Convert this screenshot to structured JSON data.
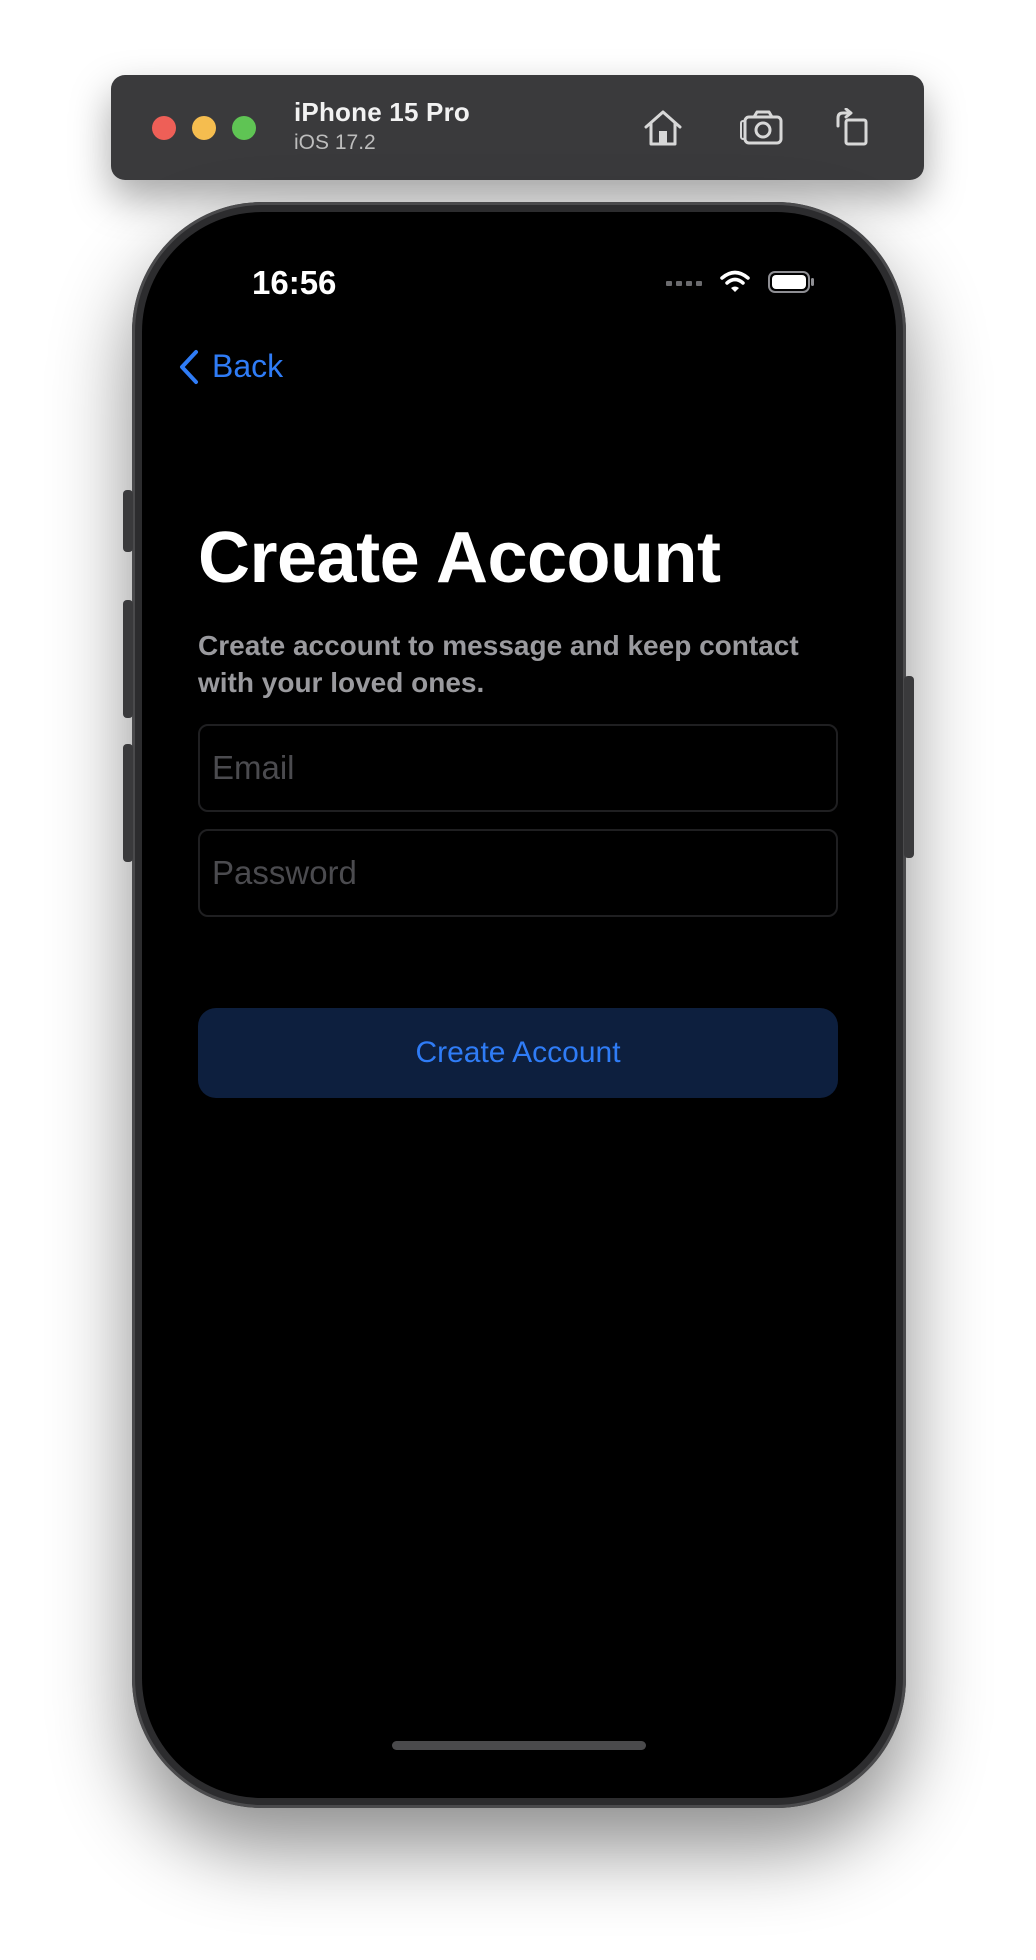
{
  "simulator": {
    "device_name": "iPhone 15 Pro",
    "os_version": "iOS 17.2",
    "toolbar_icons": [
      "home-icon",
      "screenshot-icon",
      "rotate-icon"
    ]
  },
  "status_bar": {
    "time": "16:56",
    "icons": [
      "signal-icon",
      "wifi-icon",
      "battery-icon"
    ]
  },
  "nav": {
    "back_label": "Back",
    "accent_color": "#2f7cf6"
  },
  "content": {
    "title": "Create Account",
    "subtitle": "Create account to message and keep contact with your loved ones.",
    "email_placeholder": "Email",
    "password_placeholder": "Password",
    "create_button_label": "Create Account"
  }
}
